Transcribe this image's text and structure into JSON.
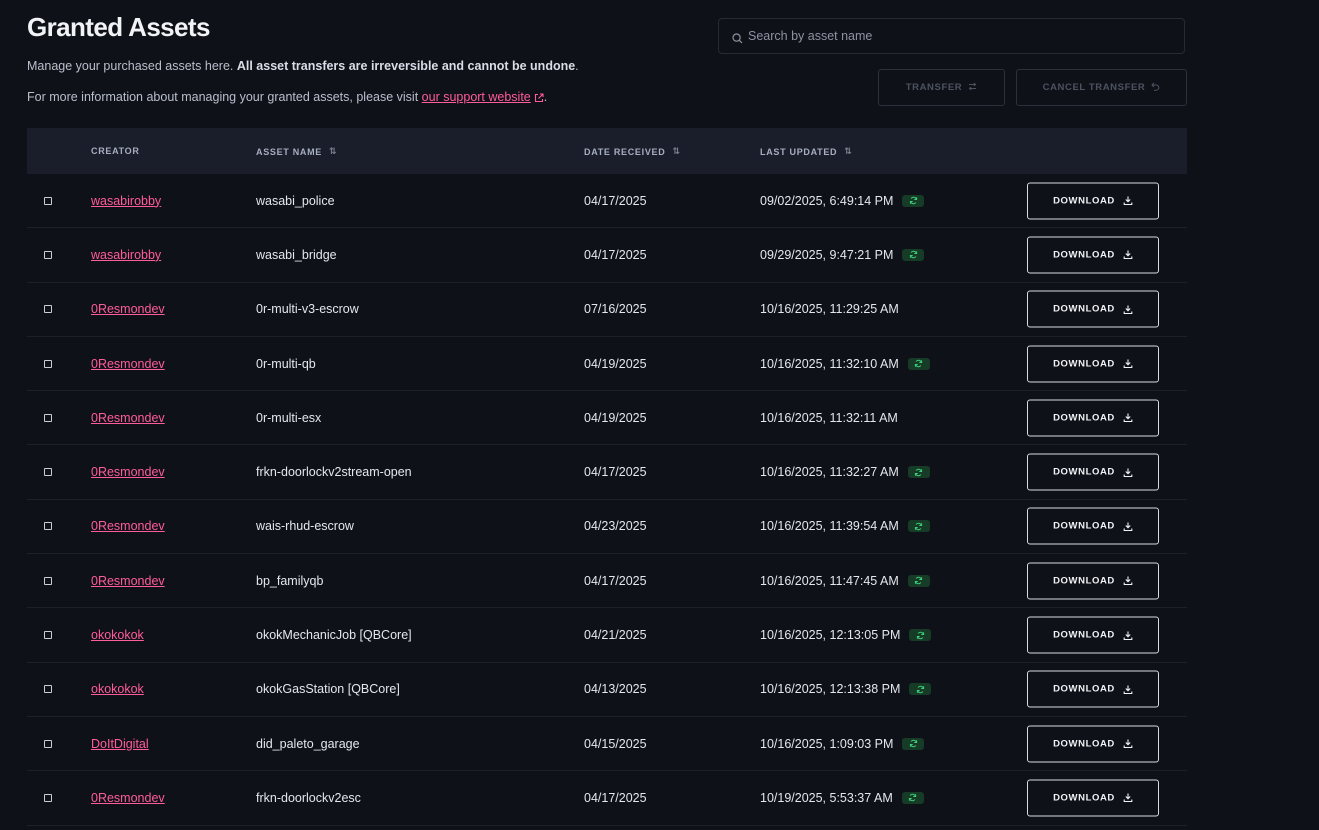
{
  "header": {
    "title": "Granted Assets",
    "desc_lead": "Manage your purchased assets here.",
    "desc_bold": "All asset transfers are irreversible and cannot be undone",
    "desc_end": ".",
    "info_lead": "For more information about managing your granted assets, please visit",
    "info_link": "our support website",
    "info_end": "."
  },
  "search": {
    "placeholder": "Search by asset name",
    "icon": "search-icon"
  },
  "actions": {
    "transfer": "TRANSFER",
    "cancel_transfer": "CANCEL TRANSFER"
  },
  "table": {
    "columns": {
      "creator": "CREATOR",
      "asset_name": "ASSET NAME",
      "date_received": "DATE RECEIVED",
      "last_updated": "LAST UPDATED"
    },
    "download_label": "DOWNLOAD",
    "rows": [
      {
        "creator": "wasabirobby",
        "asset": "wasabi_police",
        "received": "04/17/2025",
        "updated": "09/02/2025, 6:49:14 PM",
        "badge": true
      },
      {
        "creator": "wasabirobby",
        "asset": "wasabi_bridge",
        "received": "04/17/2025",
        "updated": "09/29/2025, 9:47:21 PM",
        "badge": true
      },
      {
        "creator": "0Resmondev",
        "asset": "0r-multi-v3-escrow",
        "received": "07/16/2025",
        "updated": "10/16/2025, 11:29:25 AM",
        "badge": false
      },
      {
        "creator": "0Resmondev",
        "asset": "0r-multi-qb",
        "received": "04/19/2025",
        "updated": "10/16/2025, 11:32:10 AM",
        "badge": true
      },
      {
        "creator": "0Resmondev",
        "asset": "0r-multi-esx",
        "received": "04/19/2025",
        "updated": "10/16/2025, 11:32:11 AM",
        "badge": false
      },
      {
        "creator": "0Resmondev",
        "asset": "frkn-doorlockv2stream-open",
        "received": "04/17/2025",
        "updated": "10/16/2025, 11:32:27 AM",
        "badge": true
      },
      {
        "creator": "0Resmondev",
        "asset": "wais-rhud-escrow",
        "received": "04/23/2025",
        "updated": "10/16/2025, 11:39:54 AM",
        "badge": true
      },
      {
        "creator": "0Resmondev",
        "asset": "bp_familyqb",
        "received": "04/17/2025",
        "updated": "10/16/2025, 11:47:45 AM",
        "badge": true
      },
      {
        "creator": "okokokok",
        "asset": "okokMechanicJob [QBCore]",
        "received": "04/21/2025",
        "updated": "10/16/2025, 12:13:05 PM",
        "badge": true
      },
      {
        "creator": "okokokok",
        "asset": "okokGasStation [QBCore]",
        "received": "04/13/2025",
        "updated": "10/16/2025, 12:13:38 PM",
        "badge": true
      },
      {
        "creator": "DoItDigital",
        "asset": "did_paleto_garage",
        "received": "04/15/2025",
        "updated": "10/16/2025, 1:09:03 PM",
        "badge": true
      },
      {
        "creator": "0Resmondev",
        "asset": "frkn-doorlockv2esc",
        "received": "04/17/2025",
        "updated": "10/19/2025, 5:53:37 AM",
        "badge": true
      }
    ]
  },
  "colors": {
    "accent": "#ff5c9a",
    "background": "#0f1118",
    "header_bg": "#1a1e2a",
    "badge_bg": "#163b27",
    "badge_icon": "#3ecf7a"
  }
}
